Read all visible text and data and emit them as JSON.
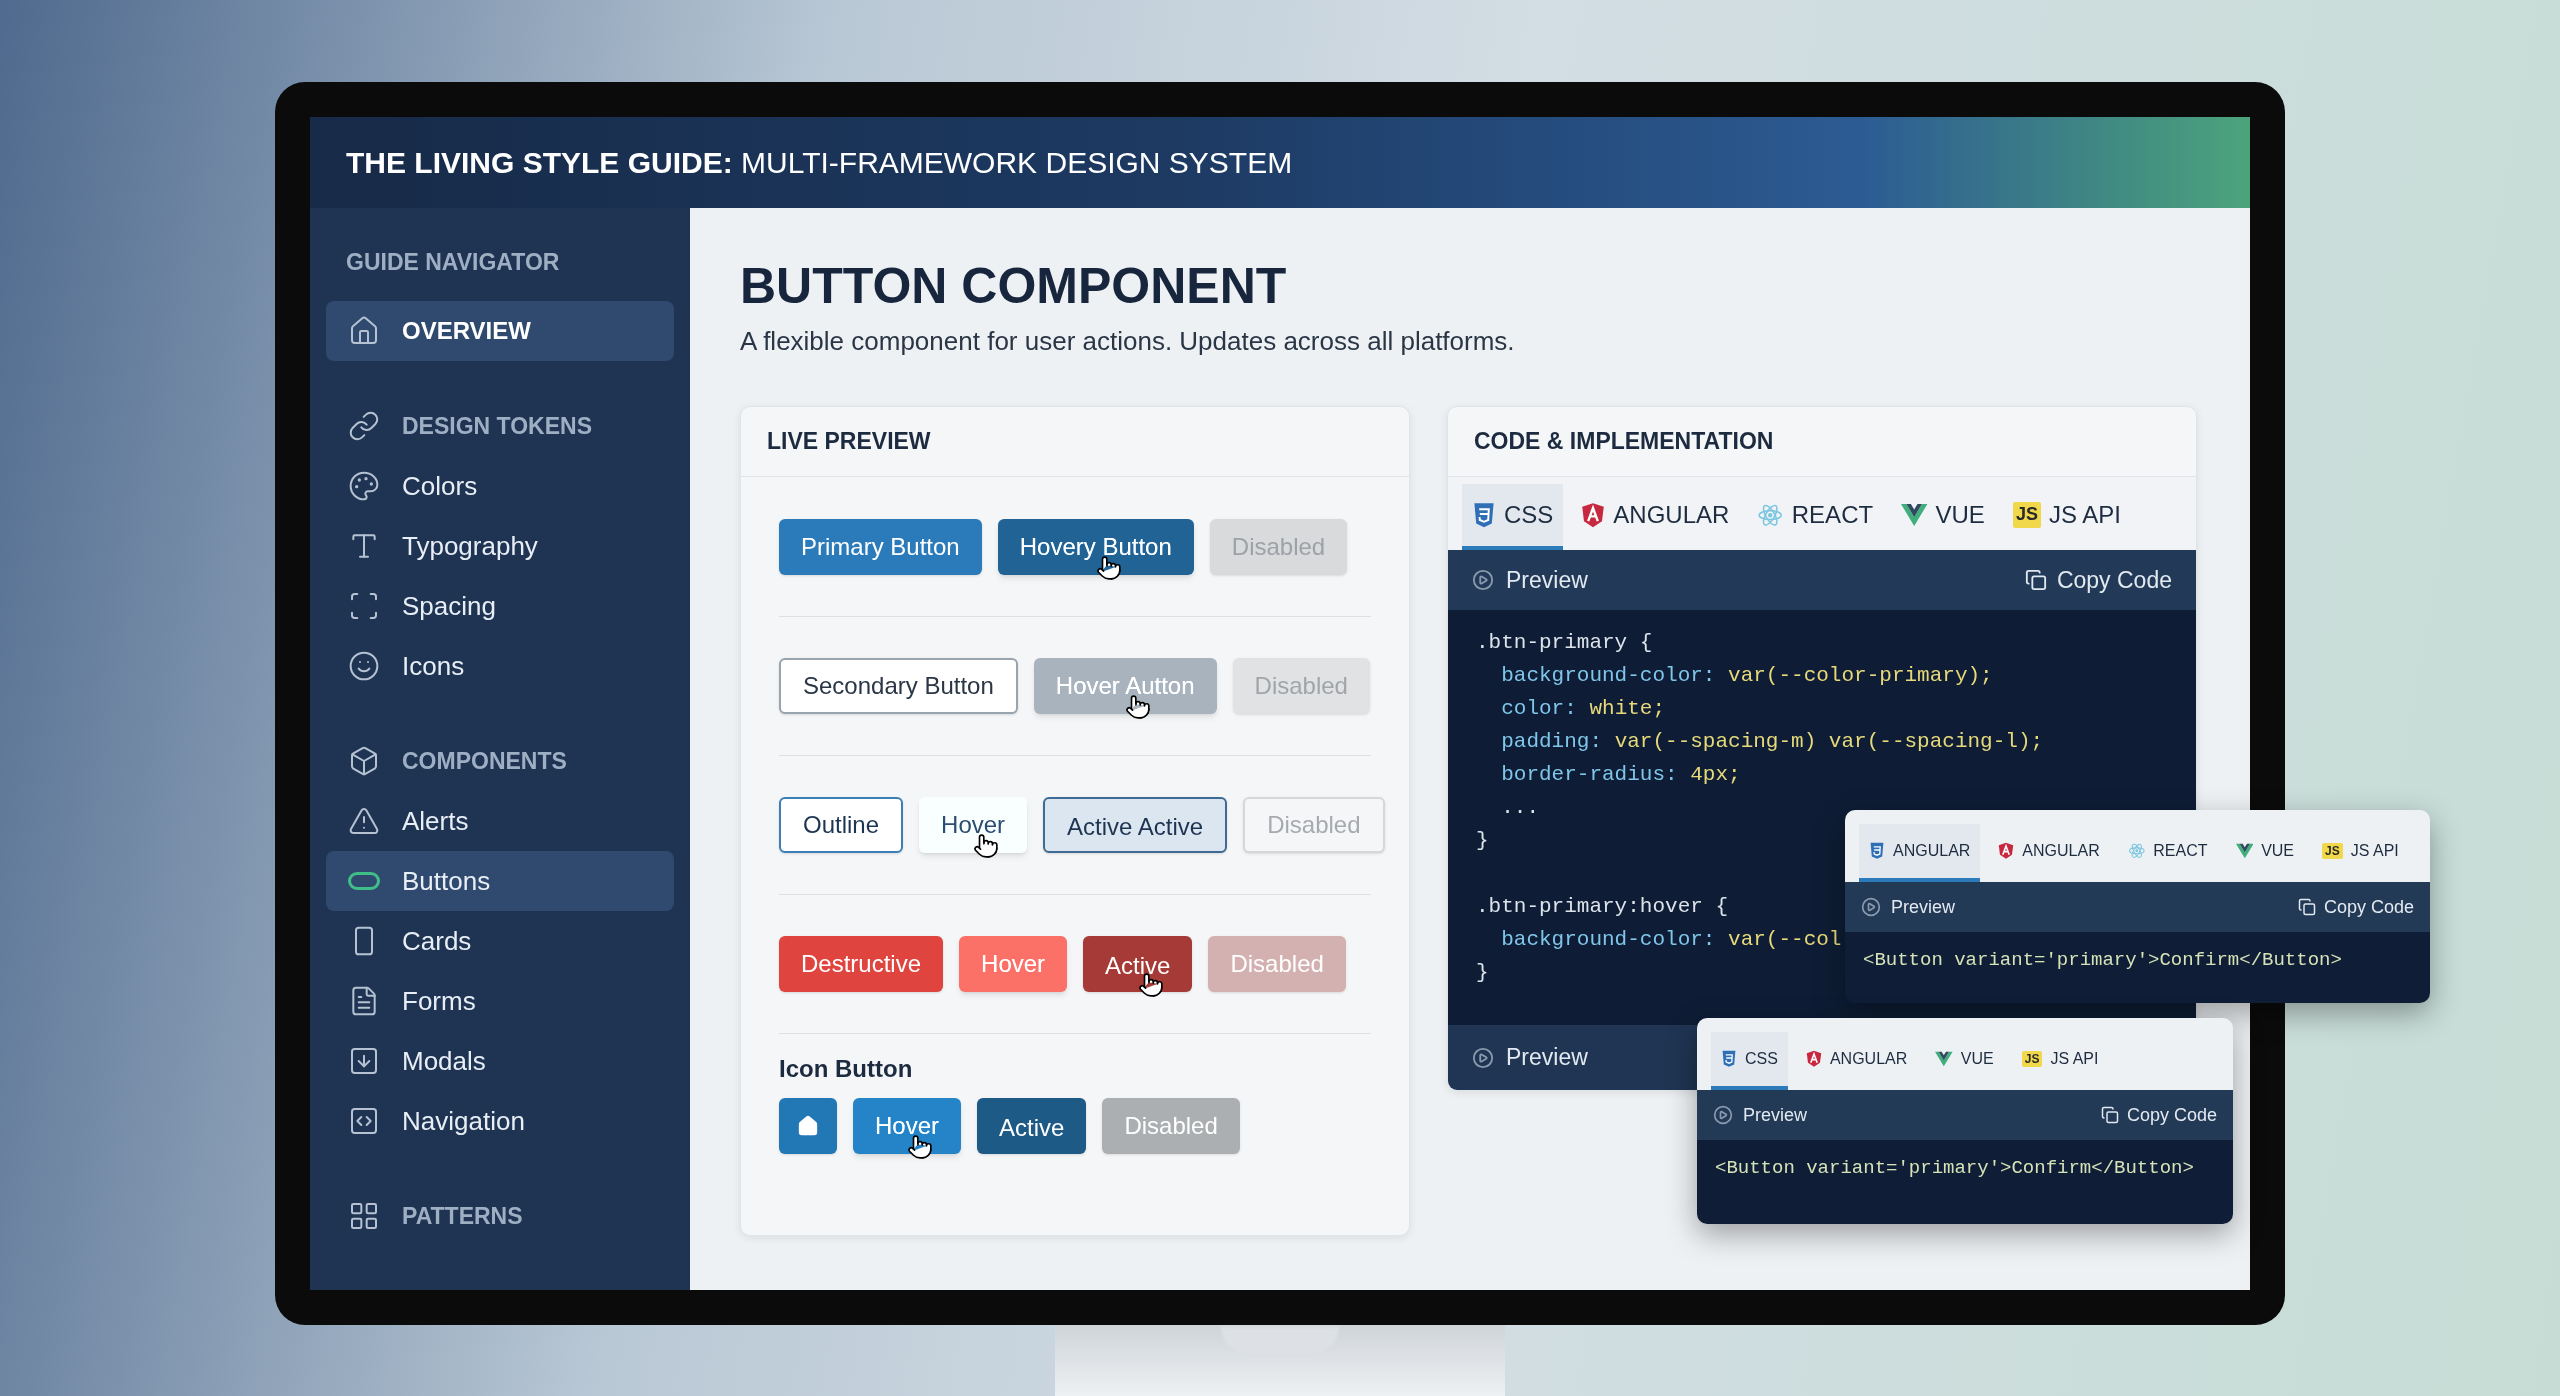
{
  "header": {
    "title": "**THE LIVING STYLE GUIDE:** MULTI-FRAMEWORK DESIGN SYSTEM"
  },
  "sidebar": {
    "title": "GUIDE NAVIGATOR",
    "items": [
      {
        "label": "OVERVIEW",
        "kind": "top",
        "selected": true
      },
      {
        "label": "DESIGN TOKENS",
        "kind": "section",
        "selected": false
      },
      {
        "label": "Colors",
        "kind": "item",
        "selected": false
      },
      {
        "label": "Typography",
        "kind": "item",
        "selected": false
      },
      {
        "label": "Spacing",
        "kind": "item",
        "selected": false
      },
      {
        "label": "Icons",
        "kind": "item",
        "selected": false
      },
      {
        "label": "COMPONENTS",
        "kind": "section",
        "selected": false
      },
      {
        "label": "Alerts",
        "kind": "item",
        "selected": false
      },
      {
        "label": "Buttons",
        "kind": "item",
        "selected": true
      },
      {
        "label": "Cards",
        "kind": "item",
        "selected": false
      },
      {
        "label": "Forms",
        "kind": "item",
        "selected": false
      },
      {
        "label": "Modals",
        "kind": "item",
        "selected": false
      },
      {
        "label": "Navigation",
        "kind": "item",
        "selected": false
      },
      {
        "label": "PATTERNS",
        "kind": "section",
        "selected": false
      }
    ]
  },
  "page": {
    "title": "BUTTON COMPONENT",
    "subtitle": "A flexible component for user actions. Updates across all platforms."
  },
  "live_preview": {
    "title": "LIVE PREVIEW",
    "rows": [
      {
        "buttons": [
          {
            "label": "Primary Button",
            "kind": "primary",
            "hovered": false,
            "pressed": false,
            "disabled": false,
            "cursor": false
          },
          {
            "label": "Hovery Button",
            "kind": "primary",
            "hovered": true,
            "pressed": false,
            "disabled": false,
            "cursor": true
          },
          {
            "label": "Disabled",
            "kind": "primary",
            "hovered": false,
            "pressed": false,
            "disabled": true,
            "cursor": false
          }
        ]
      },
      {
        "buttons": [
          {
            "label": "Secondary Button",
            "kind": "secondary",
            "hovered": false,
            "pressed": false,
            "disabled": false,
            "cursor": false
          },
          {
            "label": "Hover Autton",
            "kind": "secondary",
            "hovered": true,
            "pressed": false,
            "disabled": false,
            "cursor": true
          },
          {
            "label": "Disabled",
            "kind": "secondary",
            "hovered": false,
            "pressed": false,
            "disabled": true,
            "cursor": false
          }
        ]
      },
      {
        "buttons": [
          {
            "label": "Outline",
            "kind": "outline",
            "hovered": false,
            "pressed": false,
            "disabled": false,
            "cursor": false
          },
          {
            "label": "Hover",
            "kind": "outline",
            "hovered": true,
            "pressed": false,
            "disabled": false,
            "cursor": true
          },
          {
            "label": "Active Active",
            "kind": "outline",
            "hovered": false,
            "pressed": true,
            "disabled": false,
            "cursor": false
          },
          {
            "label": "Disabled",
            "kind": "outline",
            "hovered": false,
            "pressed": false,
            "disabled": true,
            "cursor": false
          }
        ]
      },
      {
        "buttons": [
          {
            "label": "Destructive",
            "kind": "destructive",
            "hovered": false,
            "pressed": false,
            "disabled": false,
            "cursor": false
          },
          {
            "label": "Hover",
            "kind": "destructive",
            "hovered": true,
            "pressed": false,
            "disabled": false,
            "cursor": false
          },
          {
            "label": "Active",
            "kind": "destructive",
            "hovered": false,
            "pressed": true,
            "disabled": false,
            "cursor": true
          },
          {
            "label": "Disabled",
            "kind": "destructive",
            "hovered": false,
            "pressed": false,
            "disabled": true,
            "cursor": false
          }
        ]
      },
      {
        "heading": "Icon Button",
        "buttons": [
          {
            "kind": "icon",
            "hovered": false,
            "pressed": false,
            "disabled": false,
            "cursor": false
          },
          {
            "label": "Hover",
            "kind": "icon",
            "hovered": true,
            "pressed": false,
            "disabled": false,
            "cursor": true
          },
          {
            "label": "Active",
            "kind": "icon",
            "hovered": false,
            "pressed": true,
            "disabled": false,
            "cursor": false
          },
          {
            "label": "Disabled",
            "kind": "icon",
            "hovered": false,
            "pressed": false,
            "disabled": true,
            "cursor": false
          }
        ]
      }
    ]
  },
  "code_panel": {
    "title": "CODE & IMPLEMENTATION",
    "tabs": [
      {
        "label": "CSS",
        "kind": "css",
        "selected": true
      },
      {
        "label": "ANGULAR",
        "kind": "angular",
        "selected": false
      },
      {
        "label": "REACT",
        "kind": "react",
        "selected": false
      },
      {
        "label": "VUE",
        "kind": "vue",
        "selected": false
      },
      {
        "label": "JS API",
        "kind": "js",
        "logo_text": "JS",
        "selected": false
      }
    ],
    "preview_label": "Preview",
    "copy_label": "Copy Code",
    "blocks": [
      [
        ".btn-primary {",
        "  background-color: var(--color-primary);",
        "  color: white;",
        "  padding: var(--spacing-m) var(--spacing-l);",
        "  border-radius: 4px;",
        "  ...",
        "}"
      ],
      [
        ".btn-primary:hover {",
        "  background-color: var(--col",
        "}"
      ]
    ],
    "footer_label": "Preview"
  },
  "floating_panels": [
    {
      "tabs": [
        {
          "label": "ANGULAR",
          "kind": "css",
          "selected": true
        },
        {
          "label": "ANGULAR",
          "kind": "angular",
          "selected": false
        },
        {
          "label": "REACT",
          "kind": "react",
          "selected": false
        },
        {
          "label": "VUE",
          "kind": "vue",
          "selected": false
        },
        {
          "label": "JS API",
          "kind": "js",
          "logo_text": "JS",
          "selected": false
        }
      ],
      "preview_label": "Preview",
      "copy_label": "Copy Code",
      "lines": [
        "<Button variant='primary'>Confirm</Button>"
      ]
    },
    {
      "tabs": [
        {
          "label": "CSS",
          "kind": "css",
          "selected": true
        },
        {
          "label": "ANGULAR",
          "kind": "angular",
          "selected": false
        },
        {
          "label": "VUE",
          "kind": "vue",
          "selected": false
        },
        {
          "label": "JS API",
          "kind": "js",
          "logo_text": "JS",
          "selected": false
        }
      ],
      "preview_label": "Preview",
      "copy_label": "Copy Code",
      "lines": [
        "<Button variant='primary'>Confirm</Button>"
      ]
    }
  ]
}
